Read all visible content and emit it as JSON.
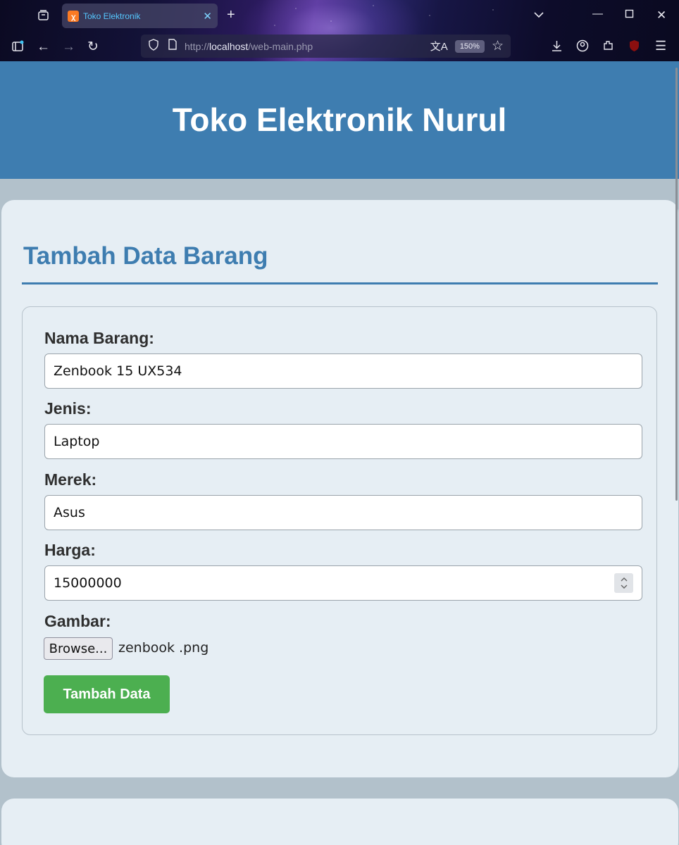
{
  "browser": {
    "tab_title": "Toko Elektronik",
    "url_prefix": "http://",
    "url_host": "localhost",
    "url_path": "/web-main.php",
    "zoom": "150%"
  },
  "header": {
    "title": "Toko Elektronik Nurul"
  },
  "form": {
    "heading": "Tambah Data Barang",
    "fields": [
      {
        "label": "Nama Barang:",
        "value": "Zenbook 15 UX534"
      },
      {
        "label": "Jenis:",
        "value": "Laptop"
      },
      {
        "label": "Merek:",
        "value": "Asus"
      },
      {
        "label": "Harga:",
        "value": "15000000"
      }
    ],
    "image_label": "Gambar:",
    "browse_label": "Browse...",
    "file_name": "zenbook .png",
    "submit_label": "Tambah Data"
  },
  "colors": {
    "header_bg": "#3e7db0",
    "submit_bg": "#4caf50",
    "card_bg": "#e6eef4",
    "page_bg": "#b2c1cb"
  }
}
